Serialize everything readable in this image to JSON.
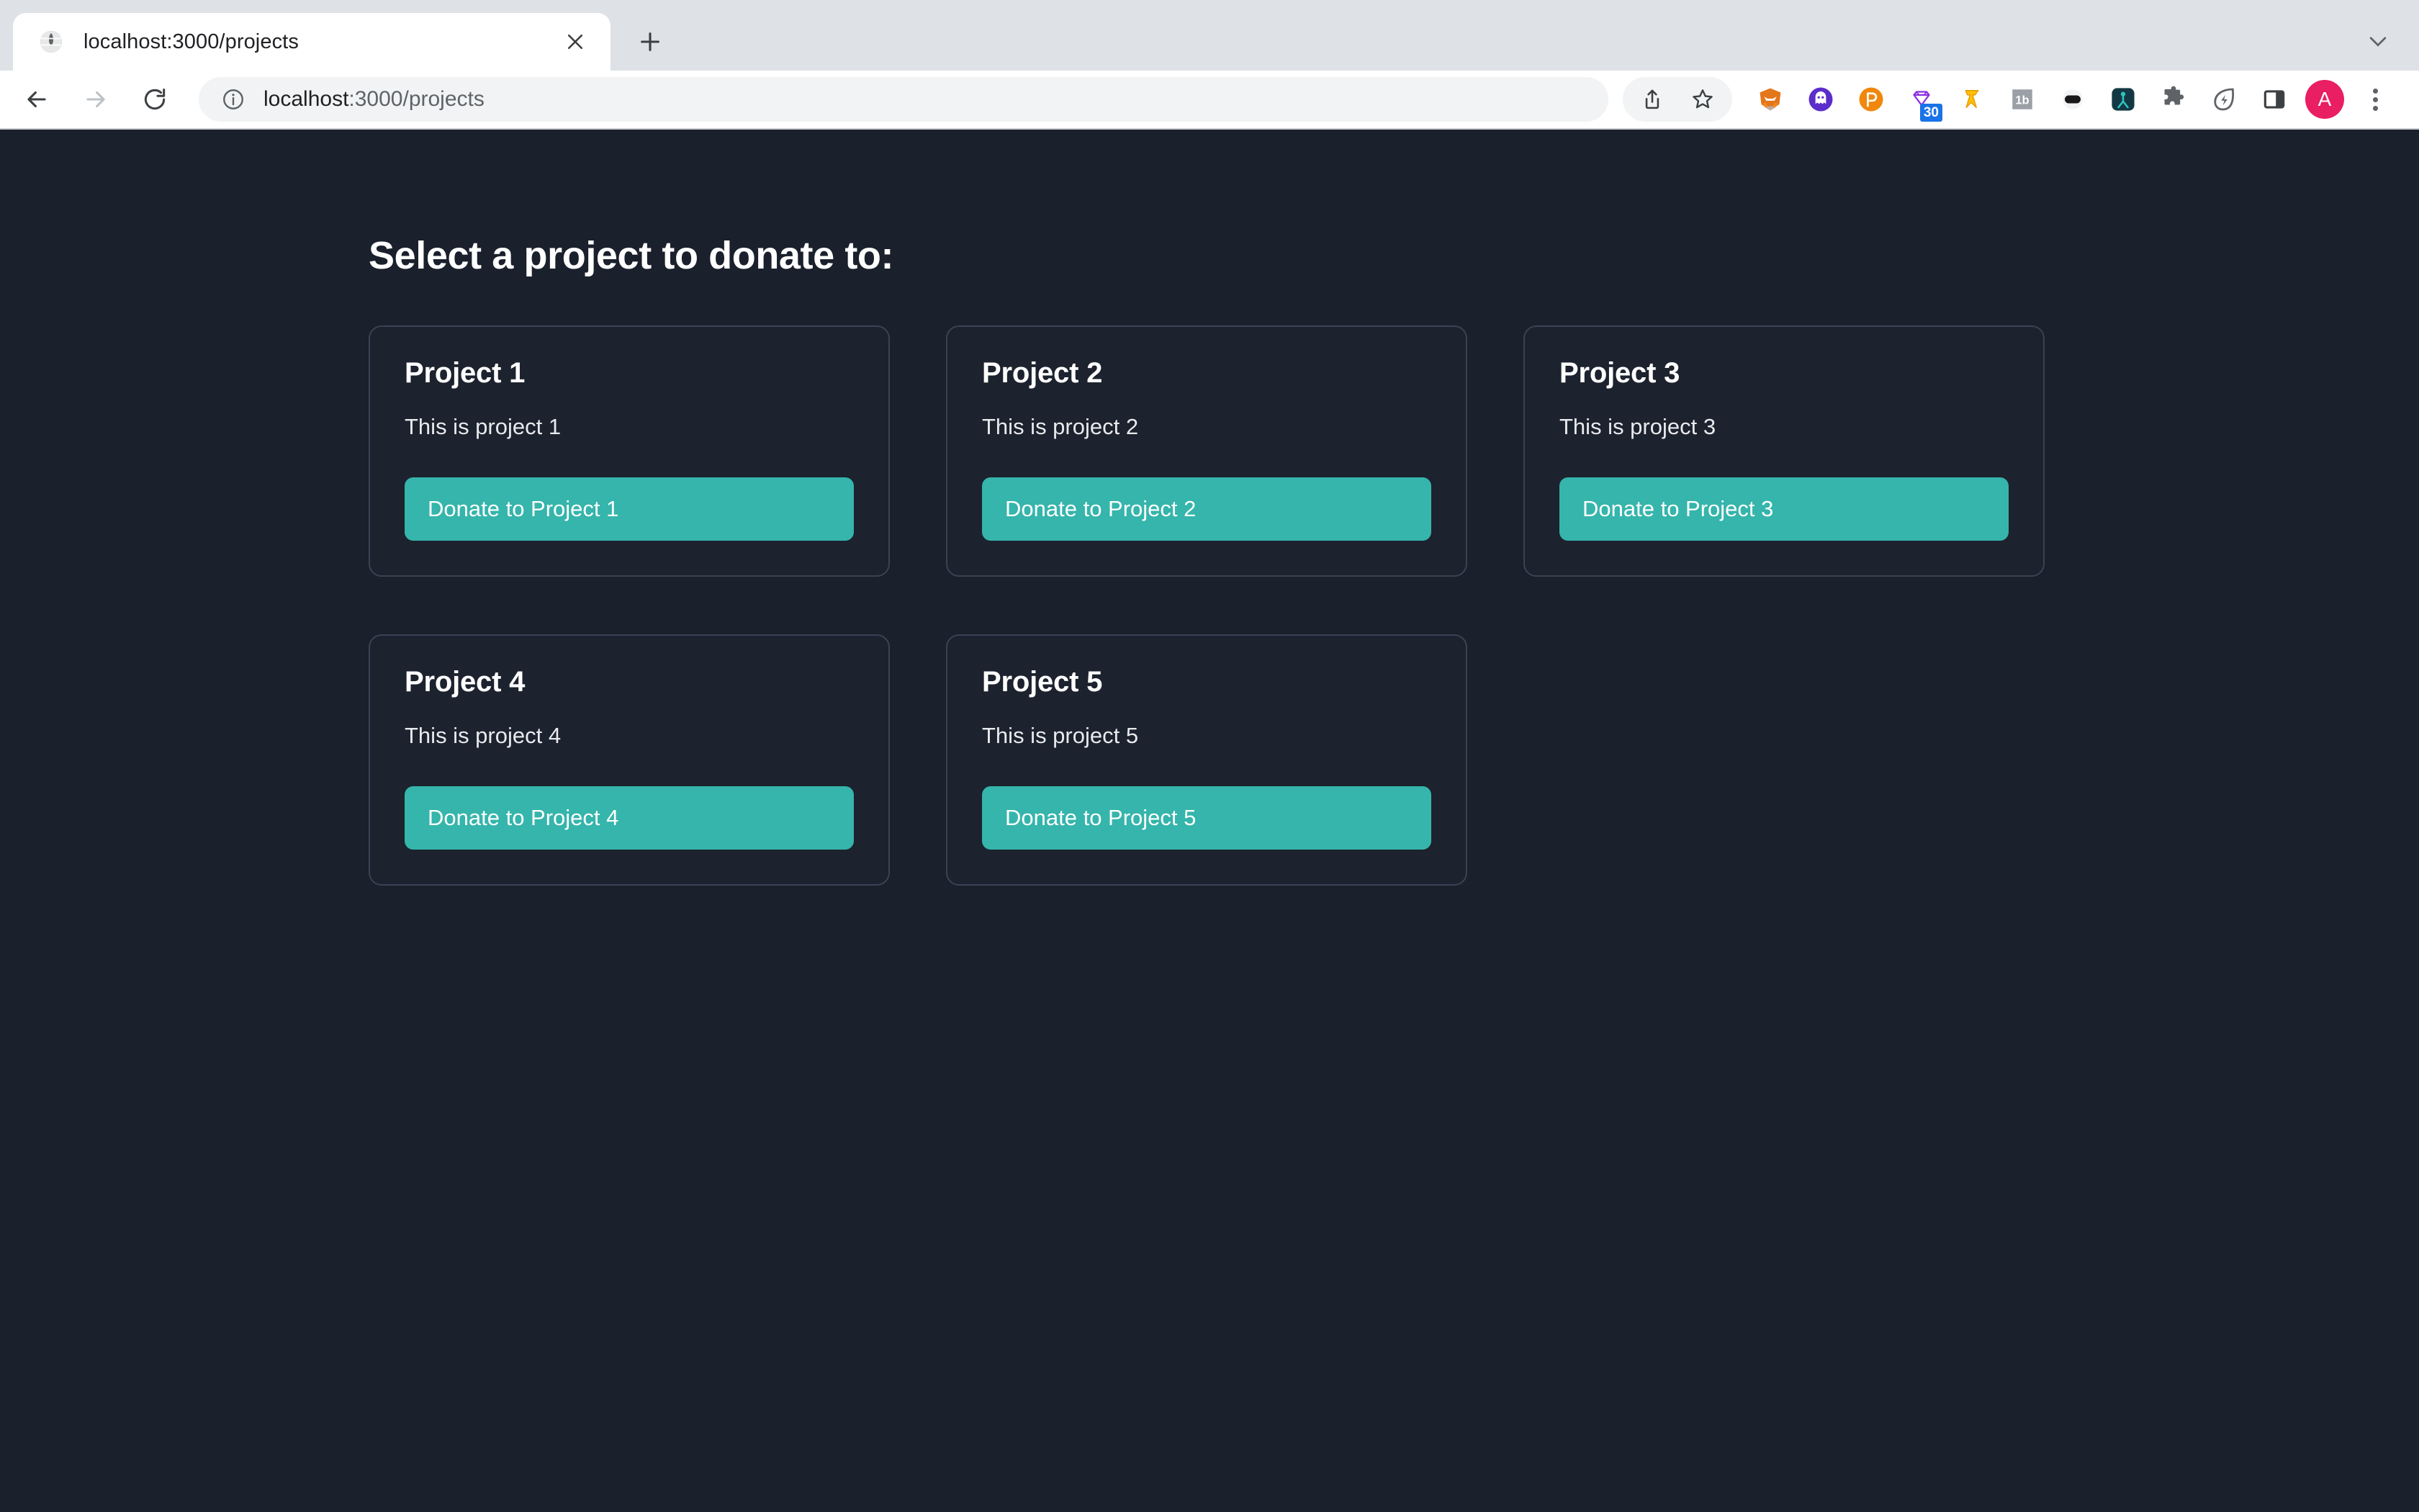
{
  "browser": {
    "tab": {
      "favicon": "globe-icon",
      "title": "localhost:3000/projects",
      "close_label": "✕"
    },
    "new_tab_label": "+",
    "window_caret_label": "˅",
    "nav": {
      "back_label": "←",
      "forward_label": "→",
      "reload_label": "↻"
    },
    "omnibox": {
      "info_icon": "info-circle-icon",
      "url_host": "localhost",
      "url_path": ":3000/projects"
    },
    "toolbar_icons": [
      {
        "name": "share-icon",
        "glyph": "⇧"
      },
      {
        "name": "bookmark-star-icon",
        "glyph": "☆"
      },
      {
        "name": "metamask-extension-icon",
        "glyph": "🦊"
      },
      {
        "name": "ghost-extension-icon",
        "glyph": "●"
      },
      {
        "name": "polkadot-extension-icon",
        "glyph": "P"
      },
      {
        "name": "diamond-extension-icon",
        "glyph": "◇",
        "badge": "30"
      },
      {
        "name": "gold-tool-extension-icon",
        "glyph": "⌇"
      },
      {
        "name": "tubebuddy-extension-icon",
        "glyph": "1b"
      },
      {
        "name": "dark-oval-extension-icon",
        "glyph": "●"
      },
      {
        "name": "teal-figure-extension-icon",
        "glyph": "☥"
      },
      {
        "name": "extensions-puzzle-icon",
        "glyph": "🧩"
      },
      {
        "name": "leaf-bolt-extension-icon",
        "glyph": "⚡"
      },
      {
        "name": "side-panel-icon",
        "glyph": "▭"
      }
    ],
    "profile_avatar_initial": "A",
    "menu_label": "chrome-menu"
  },
  "page": {
    "title": "Select a project to donate to:",
    "projects": [
      {
        "title": "Project 1",
        "description": "This is project 1",
        "button": "Donate to Project 1"
      },
      {
        "title": "Project 2",
        "description": "This is project 2",
        "button": "Donate to Project 2"
      },
      {
        "title": "Project 3",
        "description": "This is project 3",
        "button": "Donate to Project 3"
      },
      {
        "title": "Project 4",
        "description": "This is project 4",
        "button": "Donate to Project 4"
      },
      {
        "title": "Project 5",
        "description": "This is project 5",
        "button": "Donate to Project 5"
      }
    ]
  },
  "colors": {
    "page_background": "#1a202c",
    "card_background": "#1c222e",
    "card_border": "#3a4354",
    "accent_teal": "#35b5ab",
    "text_primary": "#ffffff",
    "chrome_tabstrip": "#dee1e6",
    "avatar_pink": "#e91e63",
    "badge_blue": "#1a73e8"
  }
}
